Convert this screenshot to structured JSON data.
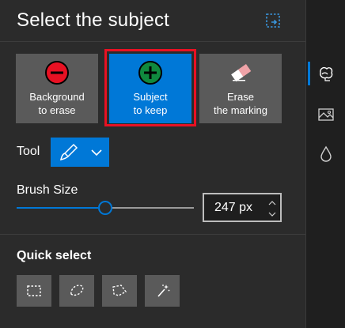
{
  "panel": {
    "title": "Select the subject",
    "title_icon": "collapse-panel-icon"
  },
  "modes": [
    {
      "label": "Background\nto erase",
      "icon": "minus-circle-icon",
      "icon_color": "#e81123",
      "active": false
    },
    {
      "label": "Subject\nto keep",
      "icon": "plus-circle-icon",
      "icon_color": "#10893e",
      "active": true
    },
    {
      "label": "Erase\nthe marking",
      "icon": "eraser-icon",
      "active": false
    }
  ],
  "tool": {
    "label": "Tool",
    "selected_icon": "brush-icon",
    "dropdown_icon": "chevron-down-icon"
  },
  "brush": {
    "label": "Brush Size",
    "value": "247 px",
    "slider_fraction": 0.5
  },
  "quick_select": {
    "label": "Quick select",
    "buttons": [
      {
        "icon": "rectangle-select-icon"
      },
      {
        "icon": "lasso-select-icon"
      },
      {
        "icon": "polygon-lasso-icon"
      },
      {
        "icon": "magic-wand-icon"
      }
    ]
  },
  "rail": {
    "items": [
      {
        "icon": "background-select-icon",
        "active": true
      },
      {
        "icon": "image-adjust-icon",
        "active": false
      },
      {
        "icon": "drop-icon",
        "active": false
      }
    ]
  },
  "colors": {
    "accent": "#0078d7",
    "selection_outline": "#e81123",
    "panel_bg": "#2b2b2b",
    "button_bg": "#5a5a5a"
  }
}
